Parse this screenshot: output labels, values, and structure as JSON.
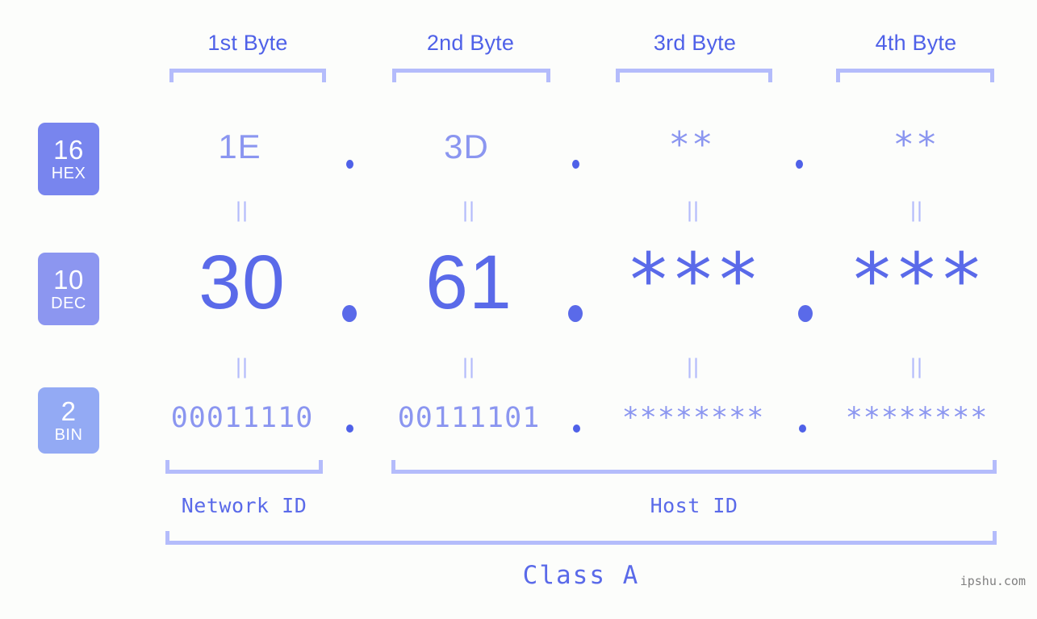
{
  "canvas": {
    "background": "#fcfdfb",
    "accent_strong": "#4f61e8",
    "accent_mid": "#8b96f0",
    "accent_light": "#b4bcfb"
  },
  "byte_headers": [
    {
      "label": "1st Byte"
    },
    {
      "label": "2nd Byte"
    },
    {
      "label": "3rd Byte"
    },
    {
      "label": "4th Byte"
    }
  ],
  "bases": [
    {
      "number": "16",
      "name": "HEX",
      "color": "#7885ee"
    },
    {
      "number": "10",
      "name": "DEC",
      "color": "#8c96f0"
    },
    {
      "number": "2",
      "name": "BIN",
      "color": "#93aaf4"
    }
  ],
  "rows": {
    "hex": {
      "base_number": "16",
      "base_name": "HEX",
      "values": [
        "1E",
        "3D",
        "**",
        "**"
      ],
      "separators": [
        ".",
        ".",
        "."
      ]
    },
    "dec": {
      "base_number": "10",
      "base_name": "DEC",
      "values": [
        "30",
        "61",
        "***",
        "***"
      ],
      "separators": [
        ".",
        ".",
        "."
      ]
    },
    "bin": {
      "base_number": "2",
      "base_name": "BIN",
      "values": [
        "00011110",
        "00111101",
        "********",
        "********"
      ],
      "separators": [
        ".",
        ".",
        "."
      ]
    }
  },
  "equal_marks": {
    "glyph": "||",
    "count_per_gap": 4,
    "gaps": 2
  },
  "sections": [
    {
      "label": "Network ID"
    },
    {
      "label": "Host ID"
    }
  ],
  "class": {
    "label": "Class A"
  },
  "watermark": {
    "text": "ipshu.com"
  }
}
